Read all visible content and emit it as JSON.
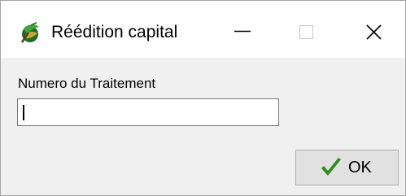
{
  "window": {
    "title": "Réédition capital",
    "icon": "leaf-globe-app-icon"
  },
  "title_bar_buttons": {
    "minimize_icon": "minimize-icon",
    "maximize_icon": "maximize-icon",
    "close_icon": "close-icon"
  },
  "form": {
    "field_label": "Numero du Traitement",
    "field_value": "",
    "field_placeholder": ""
  },
  "buttons": {
    "ok_label": "OK",
    "ok_icon": "checkmark-icon"
  },
  "colors": {
    "client_background": "#f0f0f0",
    "button_background": "#e1e1e1",
    "checkmark": "#2e8b1e"
  }
}
